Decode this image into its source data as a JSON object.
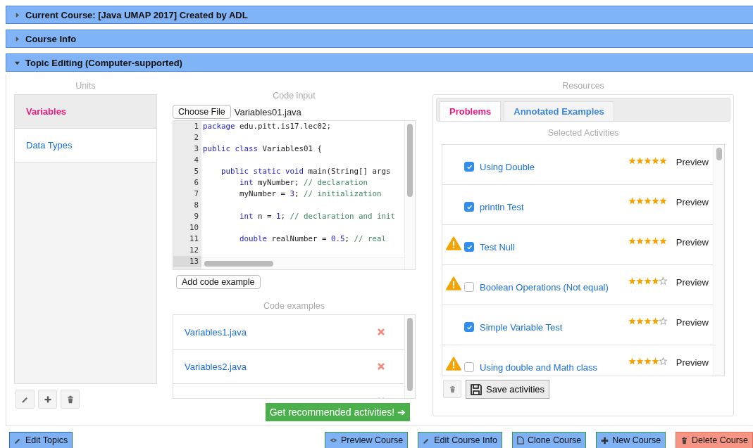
{
  "sections": [
    {
      "title": "Current Course: [Java UMAP 2017] Created by ADL",
      "expanded": false
    },
    {
      "title": "Course Info",
      "expanded": false
    },
    {
      "title": "Topic Editing (Computer-supported)",
      "expanded": true
    }
  ],
  "units": {
    "heading": "Units",
    "items": [
      {
        "label": "Variables",
        "selected": true
      },
      {
        "label": "Data Types",
        "selected": false
      }
    ]
  },
  "code_input": {
    "heading": "Code input",
    "file_button": "Choose File",
    "file_name": "Variables01.java",
    "lines": [
      {
        "number": "1",
        "tokens": [
          {
            "kind": "keyword",
            "text": "package"
          },
          {
            "kind": "plain",
            "text": " edu.pitt.is17.lec02;"
          }
        ]
      },
      {
        "number": "2"
      },
      {
        "number": "3",
        "tokens": [
          {
            "kind": "keyword",
            "text": "public class"
          },
          {
            "kind": "plain",
            "text": " Variables01 {"
          }
        ]
      },
      {
        "number": "4"
      },
      {
        "number": "5",
        "tokens": [
          {
            "kind": "keyword",
            "text": "    public static void"
          },
          {
            "kind": "plain",
            "text": " main(String[] args"
          }
        ]
      },
      {
        "number": "6",
        "tokens": [
          {
            "kind": "keyword",
            "text": "        int"
          },
          {
            "kind": "plain",
            "text": " myNumber; "
          },
          {
            "kind": "comment",
            "text": "// declaration"
          }
        ]
      },
      {
        "number": "7",
        "tokens": [
          {
            "kind": "plain",
            "text": "        myNumber = "
          },
          {
            "kind": "number",
            "text": "3"
          },
          {
            "kind": "plain",
            "text": "; "
          },
          {
            "kind": "comment",
            "text": "// initialization"
          }
        ]
      },
      {
        "number": "8"
      },
      {
        "number": "9",
        "tokens": [
          {
            "kind": "keyword",
            "text": "        int"
          },
          {
            "kind": "plain",
            "text": " n = "
          },
          {
            "kind": "number",
            "text": "1"
          },
          {
            "kind": "plain",
            "text": "; "
          },
          {
            "kind": "comment",
            "text": "// declaration and init"
          }
        ]
      },
      {
        "number": "10"
      },
      {
        "number": "11",
        "tokens": [
          {
            "kind": "keyword",
            "text": "        double"
          },
          {
            "kind": "plain",
            "text": " realNumber = "
          },
          {
            "kind": "number",
            "text": "0.5"
          },
          {
            "kind": "plain",
            "text": "; "
          },
          {
            "kind": "comment",
            "text": "// real"
          }
        ]
      },
      {
        "number": "12"
      },
      {
        "number": "13"
      }
    ],
    "add_button": "Add code example"
  },
  "code_examples": {
    "heading": "Code examples",
    "items": [
      "Variables1.java",
      "Variables2.java"
    ],
    "recommend_button": "Get recommended activities! ➔"
  },
  "resources": {
    "heading": "Resources",
    "tabs": [
      {
        "label": "Problems",
        "selected": true
      },
      {
        "label": "Annotated Examples",
        "selected": false
      }
    ],
    "subheading": "Selected Activities",
    "activities": [
      {
        "title": "Using Double",
        "checked": true,
        "warning": false,
        "stars": 5,
        "action": "Preview"
      },
      {
        "title": "println Test",
        "checked": true,
        "warning": false,
        "stars": 5,
        "action": "Preview"
      },
      {
        "title": "Test Null",
        "checked": true,
        "warning": true,
        "stars": 5,
        "action": "Preview"
      },
      {
        "title": "Boolean Operations (Not equal)",
        "checked": false,
        "warning": true,
        "stars": 4,
        "action": "Preview"
      },
      {
        "title": "Simple Variable Test",
        "checked": true,
        "warning": false,
        "stars": 4,
        "action": "Preview"
      },
      {
        "title": "Using double and Math class",
        "checked": false,
        "warning": true,
        "stars": 4,
        "action": "Preview"
      }
    ],
    "save_button": "Save activities"
  },
  "footer_buttons": [
    {
      "label": "Edit Topics",
      "kind": "edit"
    },
    {
      "label": "Preview Course",
      "kind": "preview"
    },
    {
      "label": "Edit Course Info",
      "kind": "edit"
    },
    {
      "label": "Clone Course",
      "kind": "clone"
    },
    {
      "label": "New Course",
      "kind": "new"
    },
    {
      "label": "Delete Course",
      "kind": "delete"
    }
  ]
}
